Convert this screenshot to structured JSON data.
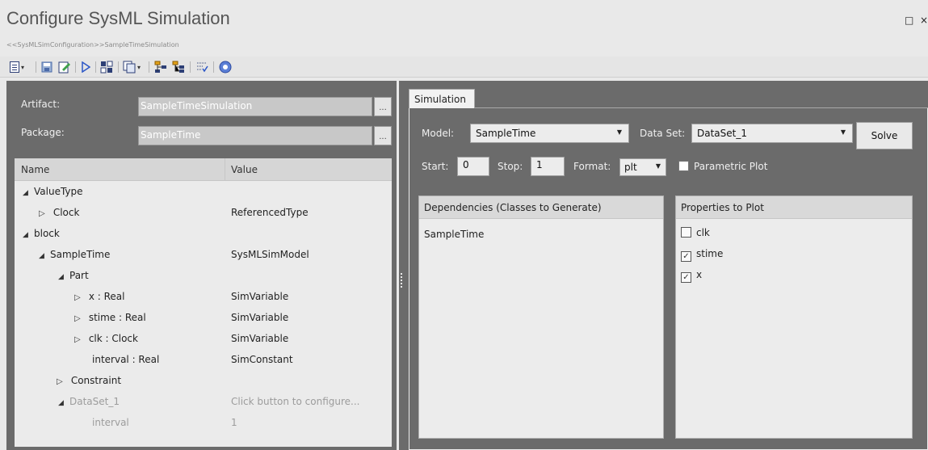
{
  "window": {
    "title": "Configure SysML Simulation",
    "subtitle": "<<SysMLSimConfiguration>>SampleTimeSimulation",
    "maximize_glyph": "□",
    "close_glyph": "×"
  },
  "toolbar": {
    "icons": [
      "new-document-icon",
      "save-icon",
      "edit-icon",
      "run-icon",
      "generate-icon",
      "copy-icon",
      "structure-icon",
      "structure-alt-icon",
      "filter-icon",
      "help-icon"
    ]
  },
  "form": {
    "artifact_label": "Artifact:",
    "artifact_value": "SampleTimeSimulation",
    "package_label": "Package:",
    "package_value": "SampleTime",
    "browse_label": "..."
  },
  "grid": {
    "columns": [
      "Name",
      "Value"
    ],
    "rows": [
      {
        "name": "ValueType",
        "value": "",
        "expander": "◢"
      },
      {
        "name": "Clock",
        "value": "ReferencedType",
        "expander": "▷"
      },
      {
        "name": "block",
        "value": "",
        "expander": "◢"
      },
      {
        "name": "SampleTime",
        "value": "SysMLSimModel",
        "expander": "◢"
      },
      {
        "name": "Part",
        "value": "",
        "expander": "◢"
      },
      {
        "name": "x : Real",
        "value": "SimVariable",
        "expander": "▷"
      },
      {
        "name": "stime : Real",
        "value": "SimVariable",
        "expander": "▷"
      },
      {
        "name": "clk : Clock",
        "value": "SimVariable",
        "expander": "▷"
      },
      {
        "name": "interval : Real",
        "value": "SimConstant",
        "expander": ""
      },
      {
        "name": "Constraint",
        "value": "",
        "expander": "▷"
      },
      {
        "name": "DataSet_1",
        "value": "Click button to configure...",
        "expander": "◢"
      },
      {
        "name": "interval",
        "value": "1",
        "expander": ""
      }
    ]
  },
  "simulation": {
    "tab_label": "Simulation",
    "model_label": "Model:",
    "model_value": "SampleTime",
    "dataset_label": "Data Set:",
    "dataset_value": "DataSet_1",
    "solve_label": "Solve",
    "start_label": "Start:",
    "start_value": "0",
    "stop_label": "Stop:",
    "stop_value": "1",
    "format_label": "Format:",
    "format_value": "plt",
    "parametric_label": "Parametric Plot",
    "dependencies_header": "Dependencies (Classes to Generate)",
    "dependencies": [
      "SampleTime"
    ],
    "properties_header": "Properties to Plot",
    "properties": [
      {
        "name": "clk",
        "checked": false,
        "mark": ""
      },
      {
        "name": "stime",
        "checked": true,
        "mark": "✓"
      },
      {
        "name": "x",
        "checked": true,
        "mark": "✓"
      }
    ]
  }
}
